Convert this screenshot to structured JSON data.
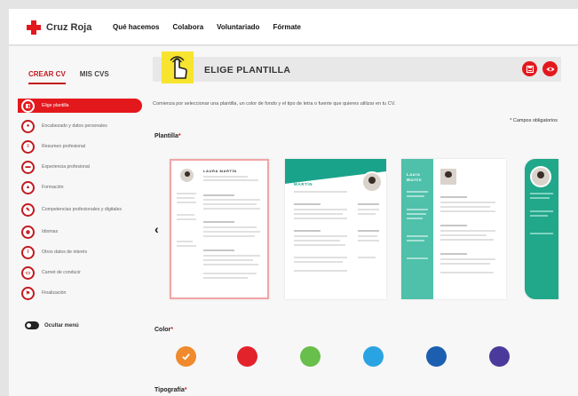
{
  "brand": {
    "name": "Cruz Roja",
    "color": "#e3181d"
  },
  "nav": {
    "items": [
      "Qué hacemos",
      "Colabora",
      "Voluntariado",
      "Fórmate"
    ]
  },
  "tabs": {
    "create": "CREAR CV",
    "mine": "MIS CVS"
  },
  "steps": [
    {
      "label": "Elige plantilla",
      "icon": "template-icon",
      "active": true
    },
    {
      "label": "Encabezado y datos personales",
      "icon": "person-icon"
    },
    {
      "label": "Resumen profesional",
      "icon": "document-icon"
    },
    {
      "label": "Experiencia profesional",
      "icon": "briefcase-icon"
    },
    {
      "label": "Formación",
      "icon": "graduation-cap-icon"
    },
    {
      "label": "Competencias profesionales y digitales",
      "icon": "skills-icon"
    },
    {
      "label": "Idiomas",
      "icon": "language-icon"
    },
    {
      "label": "Otros datos de interés",
      "icon": "info-icon"
    },
    {
      "label": "Carnet de conducir",
      "icon": "car-icon"
    },
    {
      "label": "Finalización",
      "icon": "flag-icon"
    }
  ],
  "toggle_label": "Ocultar menú",
  "header": {
    "title": "ELIGE PLANTILLA",
    "save_icon": "save-icon",
    "preview_icon": "eye-icon",
    "hand_icon": "pointer-hand-icon"
  },
  "intro": "Comienza por seleccionar una plantilla, un color de fondo y el tipo de letra o fuente que quieres utilizar en tu CV.",
  "required_note": "* Campos obligatorios",
  "template_section": {
    "label": "Plantilla",
    "asterisk": "*"
  },
  "templates": [
    {
      "name_line1": "LAURA MARTÍN",
      "name_line2": "",
      "selected": true
    },
    {
      "name_line1": "LAURA",
      "name_line2": "MARTÍN"
    },
    {
      "name_line1": "Laura",
      "name_line2": "Martín"
    },
    {
      "name_line1": "",
      "name_line2": ""
    }
  ],
  "color_section": {
    "label": "Color",
    "asterisk": "*"
  },
  "colors": [
    "#f08a2c",
    "#e3232c",
    "#68bf4b",
    "#2aa3e2",
    "#1c5fb0",
    "#4b3a9c"
  ],
  "selected_color_index": 0,
  "typography_section": {
    "label": "Tipografía",
    "asterisk": "*"
  }
}
